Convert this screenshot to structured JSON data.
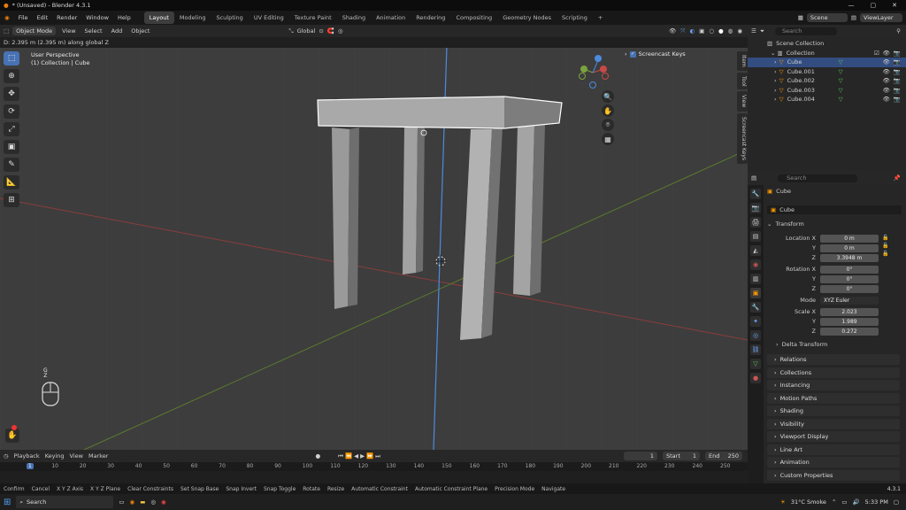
{
  "window": {
    "title": "* (Unsaved) - Blender 4.3.1"
  },
  "menus": [
    "File",
    "Edit",
    "Render",
    "Window",
    "Help"
  ],
  "workspaces": [
    "Layout",
    "Modeling",
    "Sculpting",
    "UV Editing",
    "Texture Paint",
    "Shading",
    "Animation",
    "Rendering",
    "Compositing",
    "Geometry Nodes",
    "Scripting",
    "+"
  ],
  "active_workspace": "Layout",
  "scene": {
    "name": "Scene",
    "view_layer": "ViewLayer"
  },
  "viewport_header": {
    "mode": "Object Mode",
    "menus": [
      "View",
      "Select",
      "Add",
      "Object"
    ],
    "orientation": "Global"
  },
  "operator_status": "D: 2.395 m (2.395 m) along global Z",
  "viewport": {
    "perspective": "User Perspective",
    "collection_info": "(1) Collection | Cube",
    "screencast_label": "Screencast Keys",
    "key_hint_top": "G",
    "key_hint_bottom": "Z"
  },
  "side_tabs": [
    "Item",
    "Tool",
    "View",
    "Screencast Keys"
  ],
  "outliner": {
    "search_placeholder": "Search",
    "root": "Scene Collection",
    "collection": "Collection",
    "objects": [
      "Cube",
      "Cube.001",
      "Cube.002",
      "Cube.003",
      "Cube.004"
    ],
    "selected": "Cube"
  },
  "properties": {
    "search_placeholder": "Search",
    "object_name": "Cube",
    "data_name": "Cube",
    "transform_label": "Transform",
    "location_label": "Location X",
    "location": [
      "0 m",
      "0 m",
      "3.3948 m"
    ],
    "rotation_label": "Rotation X",
    "rotation": [
      "0°",
      "0°",
      "0°"
    ],
    "mode_label": "Mode",
    "mode": "XYZ Euler",
    "scale_label": "Scale X",
    "scale": [
      "2.023",
      "1.989",
      "0.272"
    ],
    "axis_y": "Y",
    "axis_z": "Z",
    "delta": "Delta Transform",
    "panels": [
      "Relations",
      "Collections",
      "Instancing",
      "Motion Paths",
      "Shading",
      "Visibility",
      "Viewport Display",
      "Line Art",
      "Animation",
      "Custom Properties"
    ]
  },
  "timeline": {
    "menus": [
      "Playback",
      "Keying",
      "View",
      "Marker"
    ],
    "current_frame": "1",
    "start_label": "Start",
    "start": "1",
    "end_label": "End",
    "end": "250",
    "ticks": [
      "1",
      "10",
      "20",
      "30",
      "40",
      "50",
      "60",
      "70",
      "80",
      "90",
      "100",
      "110",
      "120",
      "130",
      "140",
      "150",
      "160",
      "170",
      "180",
      "190",
      "200",
      "210",
      "220",
      "230",
      "240",
      "250"
    ]
  },
  "statusbar": [
    "Confirm",
    "Cancel",
    "X Y Z Axis",
    "X Y Z Plane",
    "Clear Constraints",
    "Set Snap Base",
    "Snap Invert",
    "Snap Toggle",
    "Rotate",
    "Resize",
    "Automatic Constraint",
    "Automatic Constraint Plane",
    "Precision Mode",
    "Navigate"
  ],
  "version": "4.3.1",
  "taskbar": {
    "search": "Search",
    "weather": "31°C Smoke",
    "time": "5:33 PM"
  },
  "colors": {
    "accent": "#4772b3",
    "selection_outline": "#ffffff",
    "x_axis": "#c94848",
    "y_axis": "#7aa33d",
    "z_axis": "#4c8bde"
  }
}
